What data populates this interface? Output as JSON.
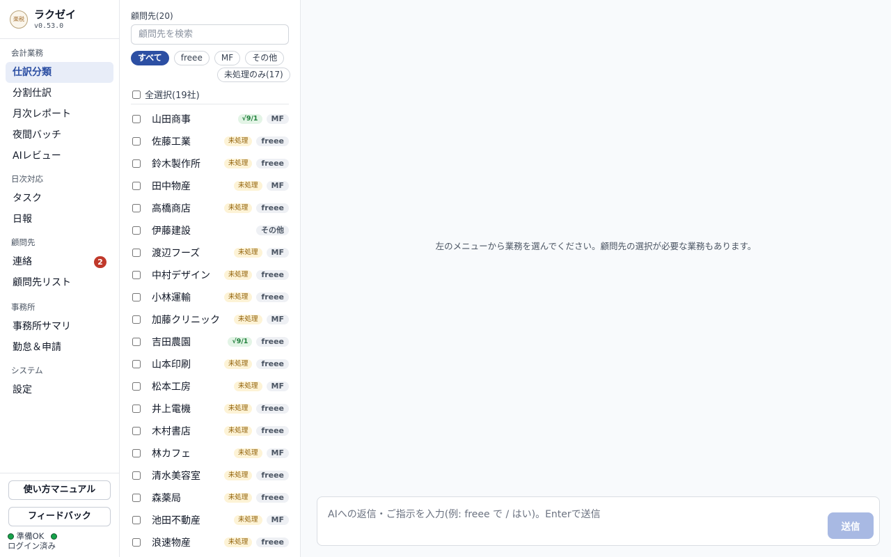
{
  "app": {
    "name": "ラクゼイ",
    "version": "v0.53.0",
    "logo_text": "楽税"
  },
  "sidebar": {
    "sections": [
      {
        "title": "会計業務",
        "items": [
          {
            "label": "仕訳分類",
            "active": true
          },
          {
            "label": "分割仕訳"
          },
          {
            "label": "月次レポート"
          },
          {
            "label": "夜間バッチ"
          },
          {
            "label": "AIレビュー"
          }
        ]
      },
      {
        "title": "日次対応",
        "items": [
          {
            "label": "タスク"
          },
          {
            "label": "日報"
          }
        ]
      },
      {
        "title": "顧問先",
        "items": [
          {
            "label": "連絡",
            "badge": "2"
          },
          {
            "label": "顧問先リスト"
          }
        ]
      },
      {
        "title": "事務所",
        "items": [
          {
            "label": "事務所サマリ"
          },
          {
            "label": "勤怠＆申請"
          }
        ]
      },
      {
        "title": "システム",
        "items": [
          {
            "label": "設定"
          }
        ]
      }
    ],
    "manual_label": "使い方マニュアル",
    "feedback_label": "フィードバック",
    "status_ready": "準備OK",
    "status_login": "ログイン済み"
  },
  "clients": {
    "title": "顧問先(20)",
    "search_placeholder": "顧問先を検索",
    "filters": [
      "すべて",
      "freee",
      "MF",
      "その他"
    ],
    "unprocessed_filter": "未処理のみ(17)",
    "select_all": "全選択(19社)",
    "items": [
      {
        "name": "山田商事",
        "status": "√9/1",
        "state": "done",
        "source": "MF"
      },
      {
        "name": "佐藤工業",
        "status": "未処理",
        "state": "pending",
        "source": "freee"
      },
      {
        "name": "鈴木製作所",
        "status": "未処理",
        "state": "pending",
        "source": "freee"
      },
      {
        "name": "田中物産",
        "status": "未処理",
        "state": "pending",
        "source": "MF"
      },
      {
        "name": "高橋商店",
        "status": "未処理",
        "state": "pending",
        "source": "freee"
      },
      {
        "name": "伊藤建設",
        "status": "",
        "state": "none",
        "source": "その他"
      },
      {
        "name": "渡辺フーズ",
        "status": "未処理",
        "state": "pending",
        "source": "MF"
      },
      {
        "name": "中村デザイン",
        "status": "未処理",
        "state": "pending",
        "source": "freee"
      },
      {
        "name": "小林運輸",
        "status": "未処理",
        "state": "pending",
        "source": "freee"
      },
      {
        "name": "加藤クリニック",
        "status": "未処理",
        "state": "pending",
        "source": "MF"
      },
      {
        "name": "吉田農園",
        "status": "√9/1",
        "state": "done",
        "source": "freee"
      },
      {
        "name": "山本印刷",
        "status": "未処理",
        "state": "pending",
        "source": "freee"
      },
      {
        "name": "松本工房",
        "status": "未処理",
        "state": "pending",
        "source": "MF"
      },
      {
        "name": "井上電機",
        "status": "未処理",
        "state": "pending",
        "source": "freee"
      },
      {
        "name": "木村書店",
        "status": "未処理",
        "state": "pending",
        "source": "freee"
      },
      {
        "name": "林カフェ",
        "status": "未処理",
        "state": "pending",
        "source": "MF"
      },
      {
        "name": "清水美容室",
        "status": "未処理",
        "state": "pending",
        "source": "freee"
      },
      {
        "name": "森薬局",
        "status": "未処理",
        "state": "pending",
        "source": "freee"
      },
      {
        "name": "池田不動産",
        "status": "未処理",
        "state": "pending",
        "source": "MF"
      },
      {
        "name": "浪速物産",
        "status": "未処理",
        "state": "pending",
        "source": "freee"
      }
    ]
  },
  "main": {
    "empty_message": "左のメニューから業務を選んでください。顧問先の選択が必要な業務もあります。",
    "input_placeholder": "AIへの返信・ご指示を入力(例: freee で / はい)。Enterで送信",
    "send_label": "送信"
  },
  "colors": {
    "accent": "#2c4fa3",
    "badge": "#c0392b",
    "ok": "#16a34a",
    "send_disabled": "#a8b9e3"
  }
}
